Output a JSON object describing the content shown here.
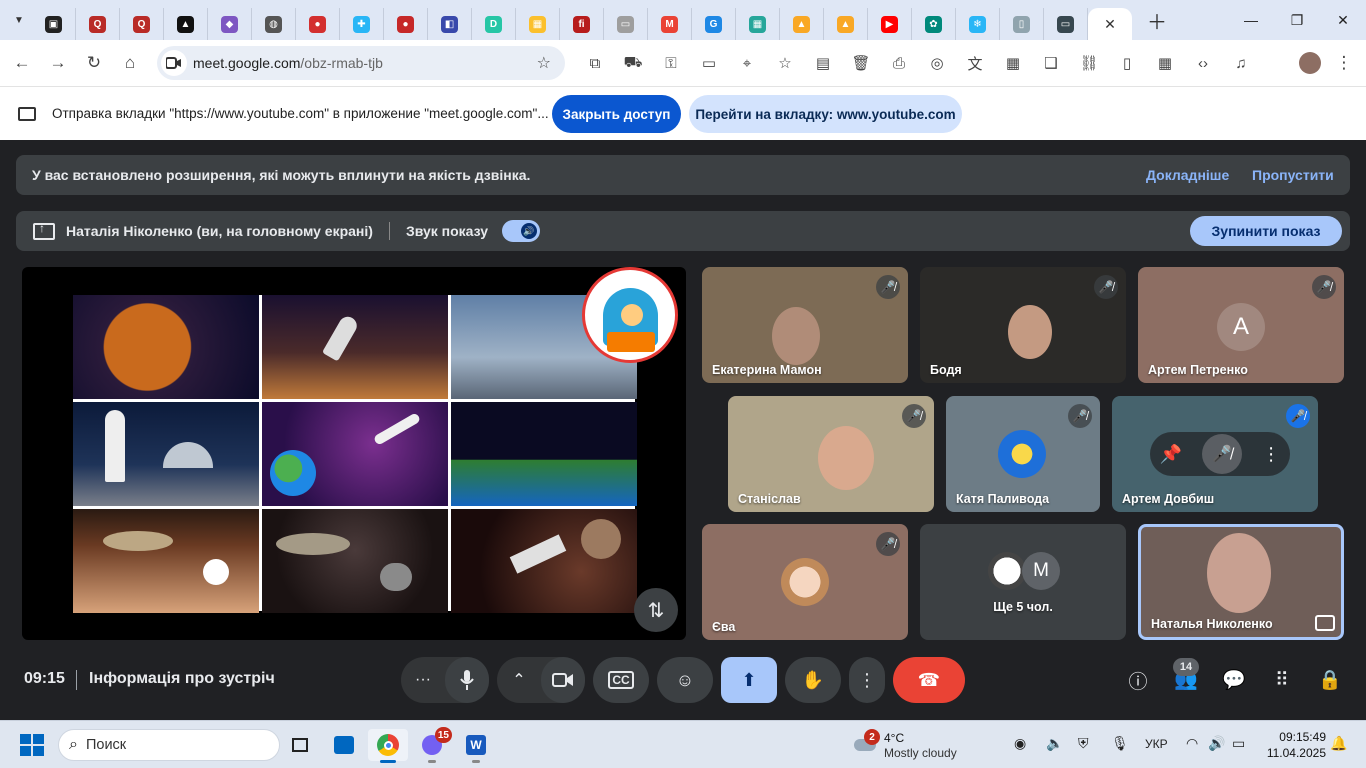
{
  "browser": {
    "tabs": [
      {
        "icon": "roblox-icon",
        "color": "#222222",
        "glyph": "▣"
      },
      {
        "icon": "quora-icon",
        "color": "#b92b27",
        "glyph": "Q"
      },
      {
        "icon": "quora-icon",
        "color": "#b92b27",
        "glyph": "Q"
      },
      {
        "icon": "ai-app-icon",
        "color": "#111111",
        "glyph": "▲"
      },
      {
        "icon": "gradient-app-icon",
        "color": "#7e57c2",
        "glyph": "◆"
      },
      {
        "icon": "globe-icon",
        "color": "#555555",
        "glyph": "◍"
      },
      {
        "icon": "red-ball-icon",
        "color": "#d32f2f",
        "glyph": "●"
      },
      {
        "icon": "puzzle-icon",
        "color": "#29b6f6",
        "glyph": "✚"
      },
      {
        "icon": "red-ball-icon",
        "color": "#c62828",
        "glyph": "●"
      },
      {
        "icon": "blue-app-icon",
        "color": "#3949ab",
        "glyph": "◧"
      },
      {
        "icon": "d-app-icon",
        "color": "#26c6a6",
        "glyph": "D"
      },
      {
        "icon": "photo-icon",
        "color": "#fbc02d",
        "glyph": "▦"
      },
      {
        "icon": "fi-icon",
        "color": "#b71c1c",
        "glyph": "fi"
      },
      {
        "icon": "slides-icon",
        "color": "#9e9e9e",
        "glyph": "▭"
      },
      {
        "icon": "gmail-icon",
        "color": "#ea4335",
        "glyph": "M"
      },
      {
        "icon": "g-app-icon",
        "color": "#1e88e5",
        "glyph": "G"
      },
      {
        "icon": "grid-app-icon",
        "color": "#26a69a",
        "glyph": "▦"
      },
      {
        "icon": "bell-icon",
        "color": "#f9a825",
        "glyph": "▲"
      },
      {
        "icon": "bell-icon",
        "color": "#f9a825",
        "glyph": "▲"
      },
      {
        "icon": "youtube-icon",
        "color": "#ff0000",
        "glyph": "▶"
      },
      {
        "icon": "chat-app-icon",
        "color": "#00897b",
        "glyph": "✿"
      },
      {
        "icon": "snowflake-icon",
        "color": "#29b6f6",
        "glyph": "❄"
      },
      {
        "icon": "cup-icon",
        "color": "#90a4ae",
        "glyph": "▯"
      },
      {
        "icon": "meet-screen-icon",
        "color": "#37474f",
        "glyph": "▭"
      }
    ],
    "url_host": "meet.google.com",
    "url_path": "/obz-rmab-tjb",
    "extensions": [
      "puzzle-icon",
      "car-icon",
      "key-icon",
      "card-icon",
      "location-icon",
      "star-list-icon",
      "notes-icon",
      "trash-icon",
      "print-icon",
      "lens-icon",
      "translate-icon",
      "qr-icon",
      "reader-icon",
      "link-icon",
      "device-icon",
      "table-icon",
      "code-icon",
      "media-icon"
    ]
  },
  "infobar": {
    "message": "Отправка вкладки \"https://www.youtube.com\" в приложение \"meet.google.com\"...",
    "close_access": "Закрыть доступ",
    "goto_tab": "Перейти на вкладку: www.youtube.com"
  },
  "banner": {
    "text": "У вас встановлено розширення, які можуть вплинути на якість дзвінка.",
    "learn_more": "Докладніше",
    "skip": "Пропустити"
  },
  "present_bar": {
    "presenter": "Наталія Ніколенко (ви, на головному екрані)",
    "sound_label": "Звук показу",
    "stop_label": "Зупинити показ"
  },
  "participants": [
    {
      "name": "Екатерина Мамон",
      "bg": "#7d6b55",
      "muted": true
    },
    {
      "name": "Бодя",
      "bg": "#2b2a28",
      "muted": true
    },
    {
      "name": "Артем Петренко",
      "bg": "#8d6e63",
      "muted": true,
      "avatar_letter": "A",
      "avatar_color": "#a1887f"
    },
    {
      "name": "Станіслав",
      "bg": "#b0a58a",
      "muted": true
    },
    {
      "name": "Катя Паливода",
      "bg": "#6d7c86",
      "muted": true
    },
    {
      "name": "Артем Довбиш",
      "bg": "#46636d",
      "muted": true
    },
    {
      "name": "Єва",
      "bg": "#8d6e63",
      "muted": true
    },
    {
      "name": "Ще 5 чол.",
      "bg": "#3c4043",
      "avatar_letter": "M",
      "avatar_color": "#5f6368"
    },
    {
      "name": "Наталья Николенко",
      "bg": "#6f5e58"
    }
  ],
  "bottom": {
    "time": "09:15",
    "meeting_info": "Інформація про зустріч",
    "people_count": "14"
  },
  "taskbar": {
    "search_placeholder": "Поиск",
    "chat_badge": "15",
    "weather_badge": "2",
    "temperature": "4°C",
    "condition": "Mostly cloudy",
    "language": "УКР",
    "time": "09:15:49",
    "date": "11.04.2025"
  }
}
